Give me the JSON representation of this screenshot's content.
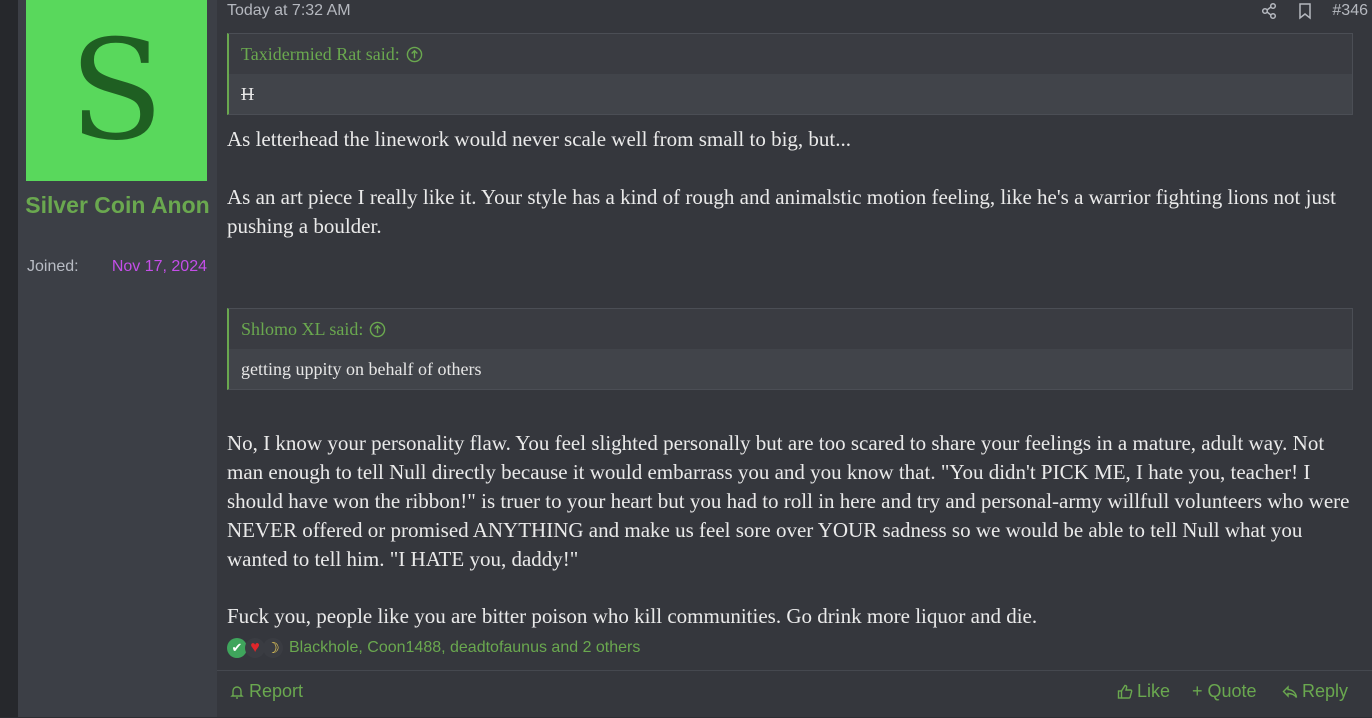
{
  "user": {
    "avatar_letter": "S",
    "name": "Silver Coin Anon",
    "joined_label": "Joined:",
    "joined_value": "Nov 17, 2024"
  },
  "post": {
    "date": "Today at 7:32 AM",
    "number": "#346",
    "quote1": {
      "author": "Taxidermied Rat said:",
      "body": "H"
    },
    "para1": "As letterhead the linework would never scale well from small to big, but...",
    "para2": "As an art piece I really like it. Your style has a kind of rough and animalstic motion feeling, like he's a warrior fighting lions not just pushing a boulder.",
    "quote2": {
      "author": "Shlomo XL said:",
      "body": "getting uppity on behalf of others"
    },
    "para3": "No, I know your personality flaw. You feel slighted personally but are too scared to share your feelings in a mature, adult way. Not man enough to tell Null directly because it would embarrass you and you know that. \"You didn't PICK ME, I hate you, teacher! I should have won the ribbon!\" is truer to your heart but you had to roll in here and try and personal-army willfull volunteers who were NEVER offered or promised ANYTHING and make us feel sore over YOUR sadness so we would be able to tell Null what you wanted to tell him. \"I HATE you, daddy!\"",
    "para4": "Fuck you, people like you are bitter poison who kill communities. Go drink more liquor and die.",
    "reactors": "Blackhole, Coon1488, deadtofaunus and 2 others"
  },
  "footer": {
    "report": "Report",
    "like": "Like",
    "quote": "+ Quote",
    "reply": "Reply"
  },
  "icons": [
    "share-icon",
    "bookmark-icon",
    "arrow-up-circle-icon",
    "bell-icon",
    "thumbs-up-icon",
    "reply-icon",
    "check-reaction-icon",
    "heart-reaction-icon",
    "moon-reaction-icon"
  ],
  "colors": {
    "accent": "#6aa84f",
    "avatar_bg": "#59d85c",
    "joined_date": "#c44ee8"
  }
}
